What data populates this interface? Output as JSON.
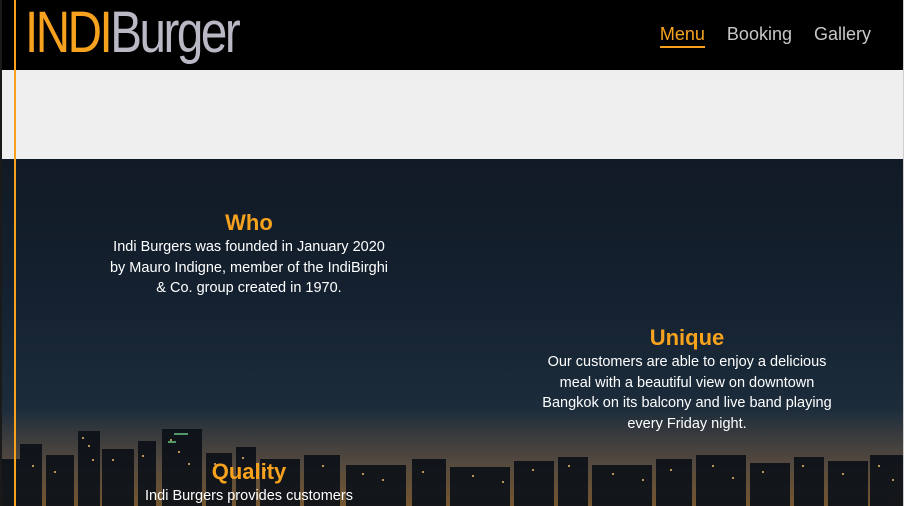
{
  "header": {
    "logo_part1": "INDI",
    "logo_part2": "Burger",
    "nav": [
      {
        "label": "Menu",
        "active": true
      },
      {
        "label": "Booking",
        "active": false
      },
      {
        "label": "Gallery",
        "active": false
      }
    ]
  },
  "colors": {
    "accent": "#f7a21e",
    "header_bg": "#000000",
    "band_bg": "#efefef",
    "nav_text": "#c7c7c7",
    "body_text": "#ffffff"
  },
  "features": {
    "who": {
      "title": "Who",
      "text": "Indi Burgers was founded in January 2020 by Mauro Indigne, member of the IndiBirghi & Co. group created in 1970."
    },
    "unique": {
      "title": "Unique",
      "text": "Our customers are able to enjoy a delicious meal with a beautiful view on downtown Bangkok on its balcony and live band playing every Friday night."
    },
    "quality": {
      "title": "Quality",
      "text": "Indi Burgers provides customers"
    }
  }
}
